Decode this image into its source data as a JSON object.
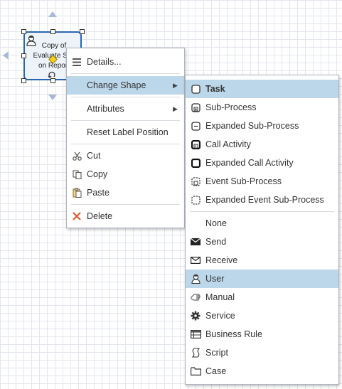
{
  "canvas": {
    "task_label": "Copy of\nEvaluate Site\non Report"
  },
  "context_menu": {
    "items": [
      {
        "label": "Details...",
        "icon": "list-icon"
      },
      {
        "label": "Change Shape",
        "icon": "",
        "submenu": true,
        "highlighted": true
      },
      {
        "label": "Attributes",
        "icon": "",
        "submenu": true
      },
      {
        "label": "Reset Label Position",
        "icon": ""
      },
      {
        "label": "Cut",
        "icon": "scissors-icon"
      },
      {
        "label": "Copy",
        "icon": "copy-icon"
      },
      {
        "label": "Paste",
        "icon": "paste-icon"
      },
      {
        "label": "Delete",
        "icon": "delete-x-icon"
      }
    ]
  },
  "shape_menu": {
    "items": [
      {
        "label": "Task",
        "icon": "task-icon",
        "bold": true,
        "highlighted": true
      },
      {
        "label": "Sub-Process",
        "icon": "sub-process-icon"
      },
      {
        "label": "Expanded Sub-Process",
        "icon": "expanded-sub-process-icon"
      },
      {
        "label": "Call Activity",
        "icon": "call-activity-icon"
      },
      {
        "label": "Expanded Call Activity",
        "icon": "expanded-call-activity-icon"
      },
      {
        "label": "Event Sub-Process",
        "icon": "event-sub-process-icon"
      },
      {
        "label": "Expanded Event Sub-Process",
        "icon": "expanded-event-sub-process-icon"
      },
      {
        "label": "None",
        "icon": ""
      },
      {
        "label": "Send",
        "icon": "send-envelope-icon"
      },
      {
        "label": "Receive",
        "icon": "receive-envelope-icon"
      },
      {
        "label": "User",
        "icon": "user-icon",
        "highlighted": true
      },
      {
        "label": "Manual",
        "icon": "hand-icon"
      },
      {
        "label": "Service",
        "icon": "gear-icon"
      },
      {
        "label": "Business Rule",
        "icon": "table-icon"
      },
      {
        "label": "Script",
        "icon": "script-icon"
      },
      {
        "label": "Case",
        "icon": "folder-icon"
      }
    ]
  },
  "colors": {
    "highlight": "#bcd6ea",
    "selection_border": "#2a66b0",
    "delete_icon": "#e05a2b"
  }
}
